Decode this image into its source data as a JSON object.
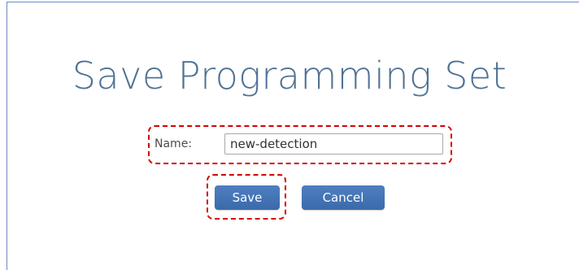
{
  "dialog": {
    "title": "Save Programming Set"
  },
  "form": {
    "name_label": "Name:",
    "name_value": "new-detection"
  },
  "buttons": {
    "save_label": "Save",
    "cancel_label": "Cancel"
  },
  "colors": {
    "title": "#4f7295",
    "button": "#3f70b2",
    "highlight_border": "#d40000",
    "frame_border": "#6b8cc7"
  }
}
